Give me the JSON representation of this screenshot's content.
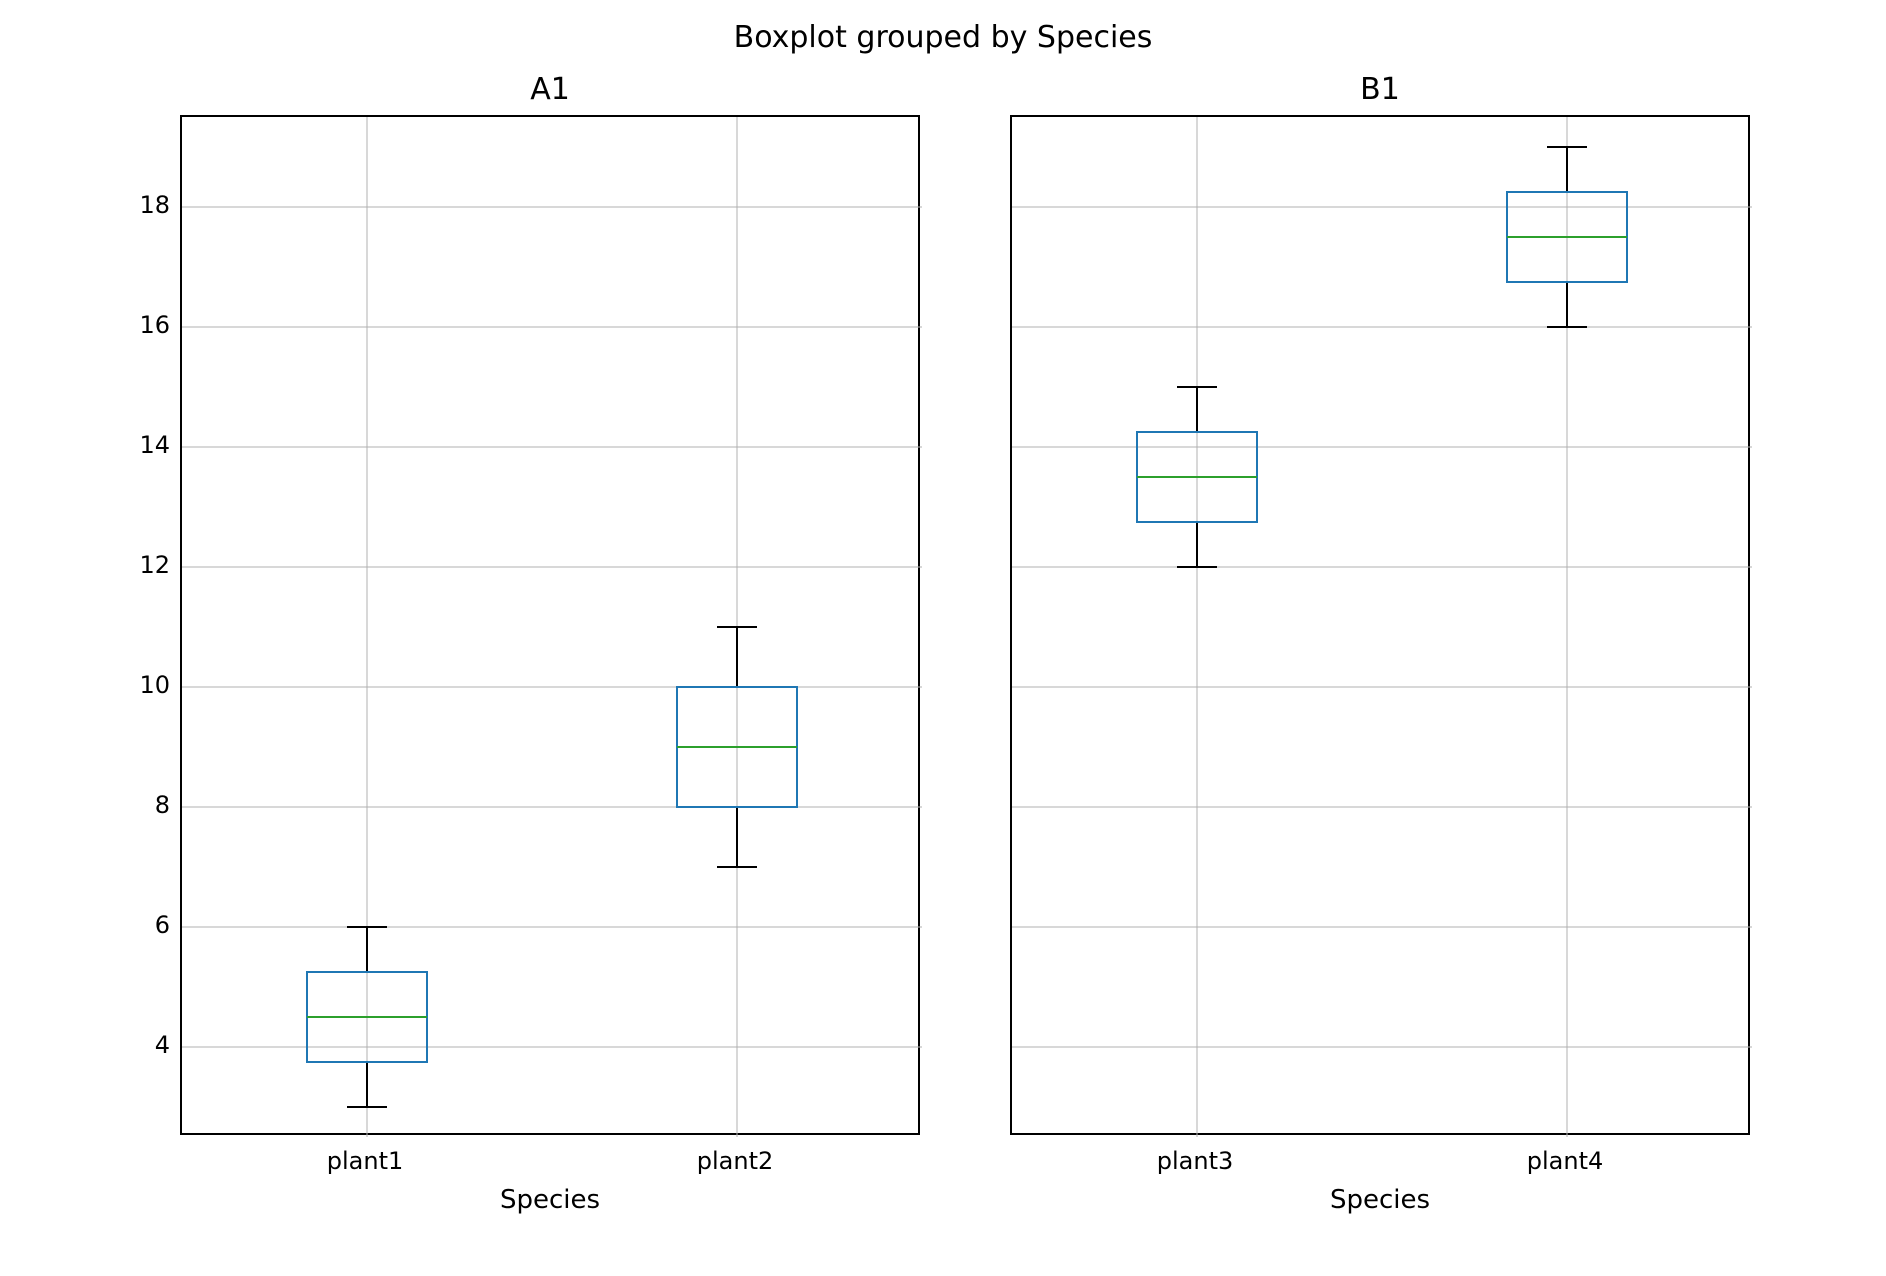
{
  "suptitle": "Boxplot grouped by Species",
  "colors": {
    "box_stroke": "#1f77b4",
    "median": "#2ca02c",
    "whisker": "#000000",
    "cap": "#000000",
    "grid": "#b0b0b0",
    "axis": "#000000"
  },
  "y_axis": {
    "min": 2.5,
    "max": 19.5,
    "ticks": [
      4,
      6,
      8,
      10,
      12,
      14,
      16,
      18
    ]
  },
  "panels": [
    {
      "id": "panel-a1",
      "title": "A1",
      "xlabel": "Species",
      "categories": [
        "plant1",
        "plant2"
      ],
      "boxes": [
        {
          "name": "plant1",
          "min": 3.0,
          "q1": 3.75,
          "median": 4.5,
          "q3": 5.25,
          "max": 6.0
        },
        {
          "name": "plant2",
          "min": 7.0,
          "q1": 8.0,
          "median": 9.0,
          "q3": 10.0,
          "max": 11.0
        }
      ]
    },
    {
      "id": "panel-b1",
      "title": "B1",
      "xlabel": "Species",
      "categories": [
        "plant3",
        "plant4"
      ],
      "boxes": [
        {
          "name": "plant3",
          "min": 12.0,
          "q1": 12.75,
          "median": 13.5,
          "q3": 14.25,
          "max": 15.0
        },
        {
          "name": "plant4",
          "min": 16.0,
          "q1": 16.75,
          "median": 17.5,
          "q3": 18.25,
          "max": 19.0
        }
      ]
    }
  ],
  "chart_data": [
    {
      "type": "boxplot",
      "title": "A1",
      "suptitle": "Boxplot grouped by Species",
      "xlabel": "Species",
      "ylabel": "",
      "ylim": [
        2.5,
        19.5
      ],
      "categories": [
        "plant1",
        "plant2"
      ],
      "series": [
        {
          "name": "plant1",
          "min": 3.0,
          "q1": 3.75,
          "median": 4.5,
          "q3": 5.25,
          "max": 6.0
        },
        {
          "name": "plant2",
          "min": 7.0,
          "q1": 8.0,
          "median": 9.0,
          "q3": 10.0,
          "max": 11.0
        }
      ]
    },
    {
      "type": "boxplot",
      "title": "B1",
      "suptitle": "Boxplot grouped by Species",
      "xlabel": "Species",
      "ylabel": "",
      "ylim": [
        2.5,
        19.5
      ],
      "categories": [
        "plant3",
        "plant4"
      ],
      "series": [
        {
          "name": "plant3",
          "min": 12.0,
          "q1": 12.75,
          "median": 13.5,
          "q3": 14.25,
          "max": 15.0
        },
        {
          "name": "plant4",
          "min": 16.0,
          "q1": 16.75,
          "median": 17.5,
          "q3": 18.25,
          "max": 19.0
        }
      ]
    }
  ]
}
